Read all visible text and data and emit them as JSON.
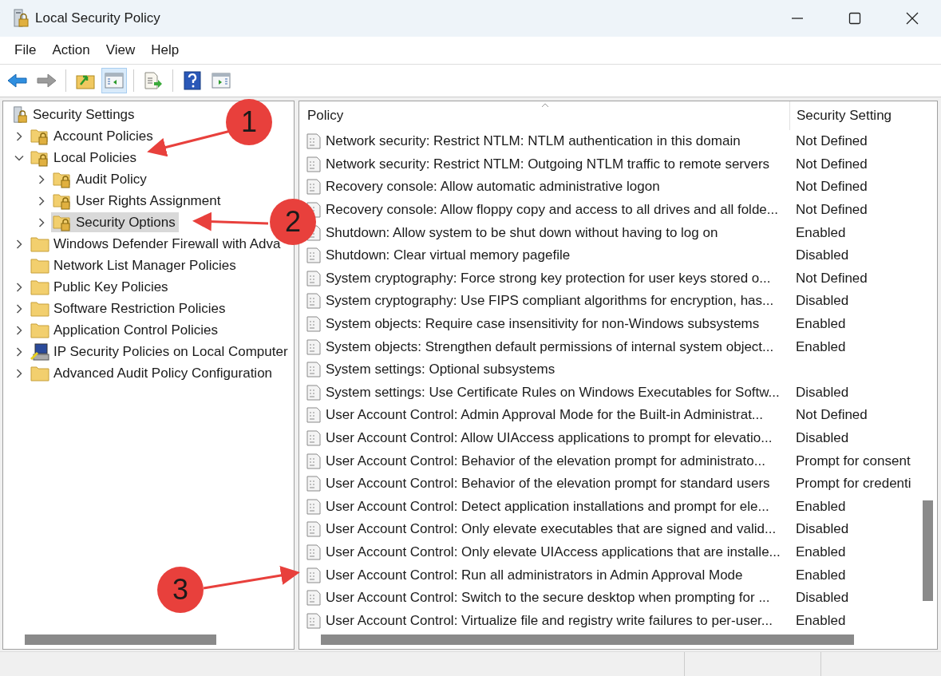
{
  "window": {
    "title": "Local Security Policy"
  },
  "menu": [
    "File",
    "Action",
    "View",
    "Help"
  ],
  "toolbar": [
    {
      "kind": "back",
      "disabled": false,
      "selected": false
    },
    {
      "kind": "forward",
      "disabled": true,
      "selected": false
    },
    {
      "kind": "sep"
    },
    {
      "kind": "up",
      "disabled": false,
      "selected": false
    },
    {
      "kind": "tree",
      "disabled": false,
      "selected": true
    },
    {
      "kind": "sep"
    },
    {
      "kind": "export",
      "disabled": false,
      "selected": false
    },
    {
      "kind": "sep"
    },
    {
      "kind": "help",
      "disabled": false,
      "selected": false
    },
    {
      "kind": "actions",
      "disabled": false,
      "selected": false
    }
  ],
  "tree": [
    {
      "label": "Security Settings",
      "kind": "server",
      "expandable": false,
      "selected": false,
      "children": [
        {
          "label": "Account Policies",
          "kind": "locked-folder",
          "expandable": true,
          "expanded": false,
          "selected": false
        },
        {
          "label": "Local Policies",
          "kind": "locked-folder",
          "expandable": true,
          "expanded": true,
          "selected": false,
          "children": [
            {
              "label": "Audit Policy",
              "kind": "locked-folder",
              "expandable": true,
              "expanded": false,
              "selected": false
            },
            {
              "label": "User Rights Assignment",
              "kind": "locked-folder",
              "expandable": true,
              "expanded": false,
              "selected": false
            },
            {
              "label": "Security Options",
              "kind": "locked-folder",
              "expandable": true,
              "expanded": false,
              "selected": true
            }
          ]
        },
        {
          "label": "Windows Defender Firewall with Adva",
          "kind": "folder",
          "expandable": true,
          "expanded": false,
          "selected": false
        },
        {
          "label": "Network List Manager Policies",
          "kind": "folder",
          "expandable": false,
          "selected": false
        },
        {
          "label": "Public Key Policies",
          "kind": "folder",
          "expandable": true,
          "expanded": false,
          "selected": false
        },
        {
          "label": "Software Restriction Policies",
          "kind": "folder",
          "expandable": true,
          "expanded": false,
          "selected": false
        },
        {
          "label": "Application Control Policies",
          "kind": "folder",
          "expandable": true,
          "expanded": false,
          "selected": false
        },
        {
          "label": "IP Security Policies on Local Computer",
          "kind": "ip-security",
          "expandable": true,
          "expanded": false,
          "selected": false
        },
        {
          "label": "Advanced Audit Policy Configuration",
          "kind": "folder",
          "expandable": true,
          "expanded": false,
          "selected": false
        }
      ]
    }
  ],
  "table": {
    "columns": [
      "Policy",
      "Security Setting"
    ],
    "rows": [
      [
        "Network security: Restrict NTLM: NTLM authentication in this domain",
        "Not Defined"
      ],
      [
        "Network security: Restrict NTLM: Outgoing NTLM traffic to remote servers",
        "Not Defined"
      ],
      [
        "Recovery console: Allow automatic administrative logon",
        "Not Defined"
      ],
      [
        "Recovery console: Allow floppy copy and access to all drives and all folde...",
        "Not Defined"
      ],
      [
        "Shutdown: Allow system to be shut down without having to log on",
        "Enabled"
      ],
      [
        "Shutdown: Clear virtual memory pagefile",
        "Disabled"
      ],
      [
        "System cryptography: Force strong key protection for user keys stored o...",
        "Not Defined"
      ],
      [
        "System cryptography: Use FIPS compliant algorithms for encryption, has...",
        "Disabled"
      ],
      [
        "System objects: Require case insensitivity for non-Windows subsystems",
        "Enabled"
      ],
      [
        "System objects: Strengthen default permissions of internal system object...",
        "Enabled"
      ],
      [
        "System settings: Optional subsystems",
        ""
      ],
      [
        "System settings: Use Certificate Rules on Windows Executables for Softw...",
        "Disabled"
      ],
      [
        "User Account Control: Admin Approval Mode for the Built-in Administrat...",
        "Not Defined"
      ],
      [
        "User Account Control: Allow UIAccess applications to prompt for elevatio...",
        "Disabled"
      ],
      [
        "User Account Control: Behavior of the elevation prompt for administrato...",
        "Prompt for consent"
      ],
      [
        "User Account Control: Behavior of the elevation prompt for standard users",
        "Prompt for credenti"
      ],
      [
        "User Account Control: Detect application installations and prompt for ele...",
        "Enabled"
      ],
      [
        "User Account Control: Only elevate executables that are signed and valid...",
        "Disabled"
      ],
      [
        "User Account Control: Only elevate UIAccess applications that are installe...",
        "Enabled"
      ],
      [
        "User Account Control: Run all administrators in Admin Approval Mode",
        "Enabled"
      ],
      [
        "User Account Control: Switch to the secure desktop when prompting for ...",
        "Disabled"
      ],
      [
        "User Account Control: Virtualize file and registry write failures to per-user...",
        "Enabled"
      ]
    ]
  },
  "callouts": [
    "1",
    "2",
    "3"
  ]
}
